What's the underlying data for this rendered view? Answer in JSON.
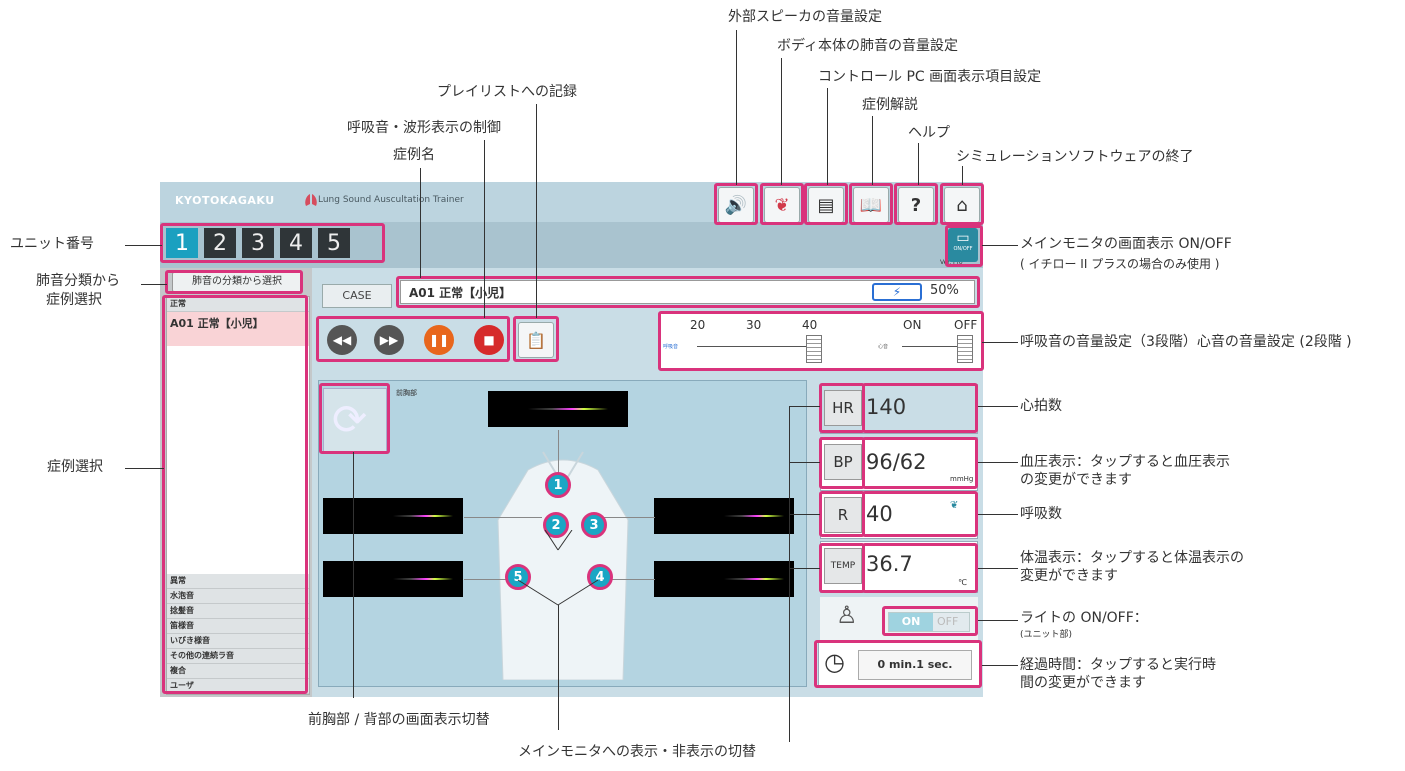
{
  "app": {
    "brand": "KYOTOKAGAKU",
    "product": "Lung Sound Auscultation Trainer",
    "version": "Ver. Pro"
  },
  "units": [
    "1",
    "2",
    "3",
    "4",
    "5"
  ],
  "active_unit": "1",
  "sidebar": {
    "select_button": "肺音の分類から選択",
    "header_category": "正常",
    "selected_case": "A01 正常【小児】",
    "categories": [
      "異常",
      "水泡音",
      "捻髪音",
      "笛様音",
      "いびき様音",
      "その他の連続ラ音",
      "複合",
      "ユーザ"
    ]
  },
  "case": {
    "button": "CASE",
    "name": "A01 正常【小児】",
    "battery": "50%"
  },
  "volume": {
    "breath_ticks": [
      "20",
      "30",
      "40"
    ],
    "heart_ticks": [
      "ON",
      "OFF"
    ],
    "breath_label": "呼吸音",
    "heart_label": "心音"
  },
  "panel": {
    "view_label": "前胸部",
    "spots": [
      "1",
      "2",
      "3",
      "4",
      "5"
    ]
  },
  "vitals": {
    "hr_label": "HR",
    "hr_value": "140",
    "bp_label": "BP",
    "bp_value": "96/62",
    "bp_unit": "mmHg",
    "r_label": "R",
    "r_value": "40",
    "temp_label": "TEMP",
    "temp_value": "36.7",
    "temp_unit": "℃",
    "light_on": "ON",
    "light_off": "OFF",
    "timer": "0 min.1 sec."
  },
  "onoff_button": "ON/OFF",
  "annotations": {
    "ext_speaker": "外部スピーカの音量設定",
    "body_volume": "ボディ本体の肺音の音量設定",
    "display_settings": "コントロール PC 画面表示項目設定",
    "case_explanation": "症例解説",
    "help": "ヘルプ",
    "exit": "シミュレーションソフトウェアの終了",
    "playlist": "プレイリストへの記録",
    "breath_wave_control": "呼吸音・波形表示の制御",
    "case_name": "症例名",
    "unit_number": "ユニット番号",
    "category_select_1": "肺音分類から",
    "category_select_2": "症例選択",
    "case_select": "症例選択",
    "main_monitor_onoff": "メインモニタの画面表示 ON/OFF",
    "main_monitor_note": "( イチロー II プラスの場合のみ使用 )",
    "volume_setting": "呼吸音の音量設定（3段階）心音の音量設定 (2段階 )",
    "heart_rate": "心拍数",
    "bp_1": "血圧表示：タップすると血圧表示",
    "bp_2": "の変更ができます",
    "resp_rate": "呼吸数",
    "temp_1": "体温表示：タップすると体温表示の",
    "temp_2": "変更ができます",
    "light": "ライトの ON/OFF：",
    "light_note": "(ユニット部)",
    "elapsed_1": "経過時間：タップすると実行時",
    "elapsed_2": "間の変更ができます",
    "view_switch": "前胸部 / 背部の画面表示切替",
    "monitor_toggle": "メインモニタへの表示・非表示の切替"
  },
  "colors": {
    "highlight": "#d9337c",
    "accent": "#1ba0c0",
    "pause": "#e8661c",
    "stop": "#d62a2a"
  }
}
